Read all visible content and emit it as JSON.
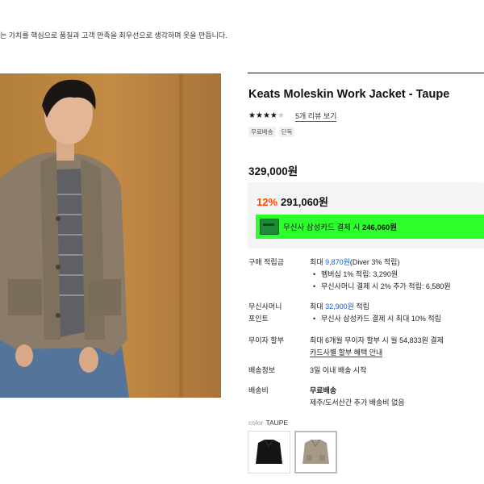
{
  "tagline": "는 가치를 핵심으로 품질과 고객 만족을 최우선으로 생각하며 옷을 만듭니다.",
  "product": {
    "title": "Keats Moleskin Work Jacket - Taupe",
    "rating": 4,
    "rating_max": 5,
    "review_link": "5개 리뷰 보기",
    "badges": [
      "무료배송",
      "단독"
    ],
    "price_original": "329,000원",
    "discount_percent": "12%",
    "price_sale": "291,060원",
    "card_promo_prefix": "무신사 삼성카드 결제 시",
    "card_promo_price": "246,060원"
  },
  "info": {
    "points_label": "구매 적립금",
    "points_prefix": "최대",
    "points_value": "9,870원",
    "points_suffix": "(Diver 3% 적립)",
    "points_sub": [
      "멤버십 1% 적립: 3,290원",
      "무신사머니 결제 시 2% 추가 적립: 6,580원"
    ],
    "money_label_1": "무신사머니",
    "money_label_2": "포인트",
    "money_prefix": "최대",
    "money_value": "32,900원",
    "money_suffix": "적립",
    "money_sub": [
      "무신사 삼성카드 결제 시 최대 10% 적립"
    ],
    "installment_label": "무이자 할부",
    "installment_text": "최대 6개월 무이자 할부 시 월 54,833원 결제",
    "installment_link": "카드사별 할부 혜택 안내",
    "delivery_info_label": "배송정보",
    "delivery_info_text": "3일 이내 배송 시작",
    "shipping_label": "배송비",
    "shipping_value": "무료배송",
    "shipping_note": "제주/도서산간 추가 배송비 없음"
  },
  "color": {
    "label": "color",
    "value": "TAUPE",
    "swatches": [
      {
        "name": "black",
        "hex": "#141414"
      },
      {
        "name": "taupe",
        "hex": "#a69a86"
      }
    ]
  },
  "colors": {
    "discount": "#ff4800",
    "promo_banner": "#2cff2c",
    "link_blue": "#1a5bd6"
  }
}
